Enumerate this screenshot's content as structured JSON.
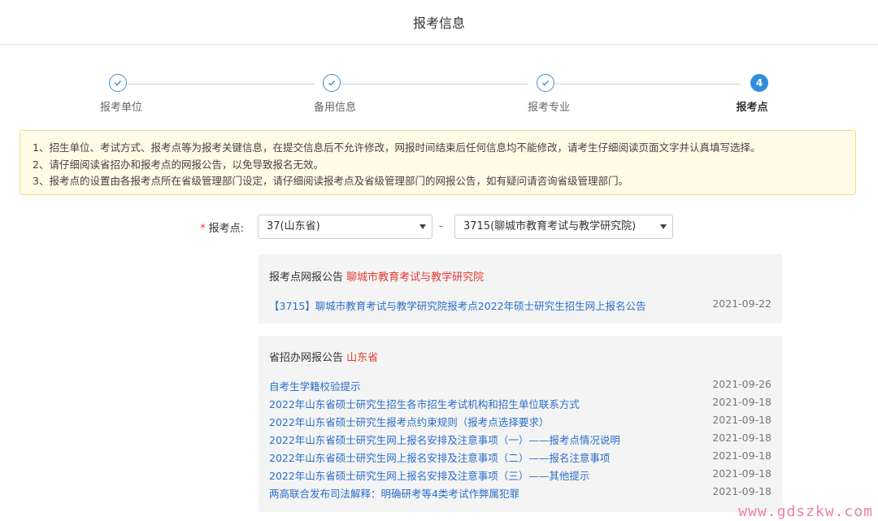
{
  "header": {
    "title": "报考信息"
  },
  "steps": [
    {
      "label": "报考单位",
      "state": "done"
    },
    {
      "label": "备用信息",
      "state": "done"
    },
    {
      "label": "报考专业",
      "state": "done"
    },
    {
      "label": "报考点",
      "state": "active",
      "number": "4"
    }
  ],
  "notice": {
    "lines": [
      "1、招生单位、考试方式、报考点等为报考关键信息，在提交信息后不允许修改，网报时间结束后任何信息均不能修改，请考生仔细阅读页面文字并认真填写选择。",
      "2、请仔细阅读省招办和报考点的网报公告，以免导致报名无效。",
      "3、报考点的设置由各报考点所在省级管理部门设定，请仔细阅读报考点及省级管理部门的网报公告，如有疑问请咨询省级管理部门。"
    ]
  },
  "form": {
    "required_mark": "*",
    "label": "报考点:",
    "province_select": "37(山东省)",
    "separator": "-",
    "site_select": "3715(聊城市教育考试与教学研究院)"
  },
  "site_panel": {
    "title_prefix": "报考点网报公告",
    "title_name": "聊城市教育考试与教学研究院",
    "items": [
      {
        "text": "【3715】聊城市教育考试与教学研究院报考点2022年硕士研究生招生网上报名公告",
        "date": "2021-09-22"
      }
    ]
  },
  "province_panel": {
    "title_prefix": "省招办网报公告",
    "title_name": "山东省",
    "items": [
      {
        "text": "自考生学籍校验提示",
        "date": "2021-09-26"
      },
      {
        "text": "2022年山东省硕士研究生招生各市招生考试机构和招生单位联系方式",
        "date": "2021-09-18"
      },
      {
        "text": "2022年山东省硕士研究生报考点约束规则（报考点选择要求）",
        "date": "2021-09-18"
      },
      {
        "text": "2022年山东省硕士研究生网上报名安排及注意事项（一）——报考点情况说明",
        "date": "2021-09-18"
      },
      {
        "text": "2022年山东省硕士研究生网上报名安排及注意事项（二）——报名注意事项",
        "date": "2021-09-18"
      },
      {
        "text": "2022年山东省硕士研究生网上报名安排及注意事项（三）——其他提示",
        "date": "2021-09-18"
      },
      {
        "text": "两高联合发布司法解释：明确研考等4类考试作弊属犯罪",
        "date": "2021-09-18"
      }
    ]
  },
  "watermark": "www.gdszkw.com",
  "colors": {
    "accent": "#2f8ee0",
    "link": "#2a6fc9",
    "highlight": "#e53935",
    "notice_bg": "#fffbe6"
  }
}
